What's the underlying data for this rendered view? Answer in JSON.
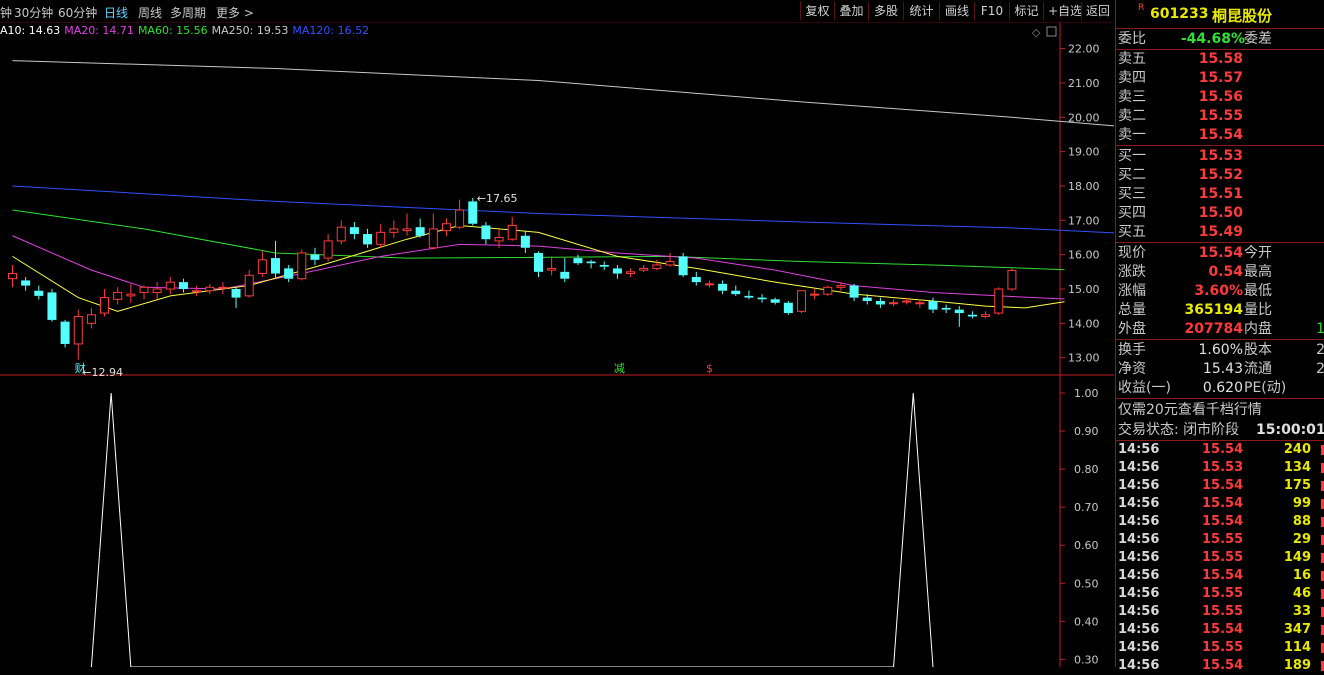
{
  "toolbar": {
    "periods": [
      {
        "label": "钟",
        "active": false
      },
      {
        "label": "30分钟",
        "active": false
      },
      {
        "label": "60分钟",
        "active": false
      },
      {
        "label": "日线",
        "active": true
      },
      {
        "label": "周线",
        "active": false
      },
      {
        "label": "多周期",
        "active": false
      },
      {
        "label": "更多 >",
        "active": false
      }
    ],
    "buttons": [
      "复权",
      "叠加",
      "多股",
      "统计",
      "画线",
      "F10",
      "标记",
      "+自选",
      "返回"
    ]
  },
  "ma_legend": [
    {
      "text": "A10: 14.63",
      "color": "#ffffff"
    },
    {
      "text": "MA20: 14.71",
      "color": "#e040e0"
    },
    {
      "text": "MA60: 15.56",
      "color": "#30e030"
    },
    {
      "text": "MA250: 19.53",
      "color": "#c8c8c8"
    },
    {
      "text": "MA120: 16.52",
      "color": "#3050ff"
    }
  ],
  "colors": {
    "up": "#ff3b3b",
    "down": "#54ffff",
    "axis_red": "#c02020"
  },
  "chart_data": [
    {
      "type": "candlestick",
      "title": "",
      "ylim": [
        12.7,
        22.25
      ],
      "y_ticks": [
        "22.00",
        "21.00",
        "20.00",
        "19.00",
        "18.00",
        "17.00",
        "16.00",
        "15.00",
        "14.00",
        "13.00"
      ],
      "candles": [
        [
          15.3,
          15.45,
          15.7,
          15.05
        ],
        [
          15.25,
          15.1,
          15.35,
          14.95
        ],
        [
          14.95,
          14.8,
          15.1,
          14.7
        ],
        [
          14.9,
          14.1,
          15.0,
          14.05
        ],
        [
          14.05,
          13.4,
          14.1,
          13.3
        ],
        [
          13.4,
          14.2,
          14.4,
          12.94
        ],
        [
          14.0,
          14.25,
          14.45,
          13.85
        ],
        [
          14.3,
          14.75,
          15.0,
          14.2
        ],
        [
          14.7,
          14.9,
          15.05,
          14.55
        ],
        [
          14.8,
          14.85,
          15.15,
          14.6
        ],
        [
          14.9,
          15.05,
          15.1,
          14.7
        ],
        [
          14.9,
          15.0,
          15.2,
          14.7
        ],
        [
          15.0,
          15.2,
          15.35,
          14.85
        ],
        [
          15.2,
          15.0,
          15.3,
          14.9
        ],
        [
          14.95,
          14.95,
          15.1,
          14.8
        ],
        [
          14.95,
          15.05,
          15.15,
          14.85
        ],
        [
          15.05,
          15.05,
          15.2,
          14.85
        ],
        [
          15.0,
          14.75,
          15.05,
          14.45
        ],
        [
          14.8,
          15.4,
          15.55,
          14.75
        ],
        [
          15.45,
          15.85,
          16.1,
          15.35
        ],
        [
          15.9,
          15.45,
          16.4,
          15.3
        ],
        [
          15.6,
          15.3,
          15.7,
          15.2
        ],
        [
          15.3,
          16.05,
          16.15,
          15.25
        ],
        [
          16.0,
          15.85,
          16.2,
          15.7
        ],
        [
          15.9,
          16.4,
          16.6,
          15.8
        ],
        [
          16.4,
          16.8,
          17.0,
          16.3
        ],
        [
          16.8,
          16.6,
          16.95,
          16.45
        ],
        [
          16.6,
          16.3,
          16.75,
          16.2
        ],
        [
          16.3,
          16.65,
          16.9,
          16.2
        ],
        [
          16.65,
          16.75,
          17.0,
          16.5
        ],
        [
          16.7,
          16.75,
          17.2,
          16.55
        ],
        [
          16.8,
          16.55,
          17.05,
          16.5
        ],
        [
          16.2,
          16.75,
          17.2,
          16.15
        ],
        [
          16.7,
          16.9,
          17.05,
          16.55
        ],
        [
          16.8,
          17.3,
          17.6,
          16.75
        ],
        [
          17.55,
          16.9,
          17.65,
          16.85
        ],
        [
          16.85,
          16.45,
          16.95,
          16.3
        ],
        [
          16.4,
          16.5,
          16.75,
          16.2
        ],
        [
          16.45,
          16.85,
          17.1,
          16.4
        ],
        [
          16.55,
          16.2,
          16.7,
          16.05
        ],
        [
          16.05,
          15.5,
          16.1,
          15.35
        ],
        [
          15.55,
          15.6,
          15.95,
          15.4
        ],
        [
          15.5,
          15.3,
          15.9,
          15.2
        ],
        [
          15.9,
          15.75,
          16.0,
          15.7
        ],
        [
          15.8,
          15.75,
          15.85,
          15.6
        ],
        [
          15.7,
          15.65,
          15.8,
          15.55
        ],
        [
          15.6,
          15.45,
          15.7,
          15.3
        ],
        [
          15.45,
          15.5,
          15.6,
          15.35
        ],
        [
          15.55,
          15.6,
          15.7,
          15.5
        ],
        [
          15.6,
          15.7,
          15.85,
          15.55
        ],
        [
          15.7,
          15.8,
          16.05,
          15.65
        ],
        [
          15.95,
          15.4,
          16.05,
          15.35
        ],
        [
          15.35,
          15.2,
          15.5,
          15.1
        ],
        [
          15.15,
          15.15,
          15.25,
          15.05
        ],
        [
          15.15,
          14.95,
          15.25,
          14.85
        ],
        [
          14.95,
          14.85,
          15.1,
          14.8
        ],
        [
          14.8,
          14.75,
          14.95,
          14.7
        ],
        [
          14.75,
          14.7,
          14.85,
          14.6
        ],
        [
          14.7,
          14.6,
          14.75,
          14.55
        ],
        [
          14.6,
          14.3,
          14.65,
          14.25
        ],
        [
          14.35,
          14.95,
          14.95,
          14.3
        ],
        [
          14.85,
          14.85,
          15.0,
          14.7
        ],
        [
          14.85,
          15.05,
          15.1,
          14.8
        ],
        [
          15.05,
          15.1,
          15.2,
          14.95
        ],
        [
          15.1,
          14.75,
          15.15,
          14.65
        ],
        [
          14.75,
          14.65,
          14.85,
          14.55
        ],
        [
          14.65,
          14.55,
          14.75,
          14.45
        ],
        [
          14.6,
          14.6,
          14.7,
          14.5
        ],
        [
          14.65,
          14.65,
          14.75,
          14.55
        ],
        [
          14.6,
          14.6,
          14.7,
          14.45
        ],
        [
          14.65,
          14.4,
          14.75,
          14.3
        ],
        [
          14.45,
          14.4,
          14.55,
          14.3
        ],
        [
          14.4,
          14.3,
          14.5,
          13.9
        ],
        [
          14.25,
          14.2,
          14.35,
          14.15
        ],
        [
          14.2,
          14.25,
          14.35,
          14.15
        ],
        [
          14.3,
          15.0,
          15.05,
          14.25
        ],
        [
          15.0,
          15.54,
          15.6,
          14.95
        ]
      ],
      "ma_lines": [
        {
          "name": "MA250",
          "color": "#c8c8c8",
          "values": [
            [
              0,
              21.65
            ],
            [
              20,
              21.42
            ],
            [
              40,
              21.07
            ],
            [
              60,
              20.45
            ],
            [
              76,
              20.0
            ],
            [
              90,
              19.55
            ]
          ]
        },
        {
          "name": "MA120",
          "color": "#3050ff",
          "values": [
            [
              0,
              18.0
            ],
            [
              20,
              17.55
            ],
            [
              40,
              17.2
            ],
            [
              60,
              16.95
            ],
            [
              76,
              16.78
            ],
            [
              90,
              16.52
            ]
          ]
        },
        {
          "name": "MA60",
          "color": "#30e030",
          "values": [
            [
              0,
              17.3
            ],
            [
              10,
              16.75
            ],
            [
              20,
              16.05
            ],
            [
              30,
              15.9
            ],
            [
              40,
              15.92
            ],
            [
              50,
              15.95
            ],
            [
              60,
              15.8
            ],
            [
              70,
              15.7
            ],
            [
              76,
              15.62
            ],
            [
              80,
              15.56
            ]
          ]
        },
        {
          "name": "MA20",
          "color": "#e040e0",
          "values": [
            [
              0,
              16.55
            ],
            [
              6,
              15.55
            ],
            [
              10,
              15.05
            ],
            [
              16,
              15.0
            ],
            [
              22,
              15.45
            ],
            [
              28,
              15.95
            ],
            [
              34,
              16.3
            ],
            [
              40,
              16.25
            ],
            [
              46,
              16.05
            ],
            [
              52,
              15.9
            ],
            [
              58,
              15.55
            ],
            [
              64,
              15.1
            ],
            [
              70,
              14.9
            ],
            [
              76,
              14.78
            ],
            [
              80,
              14.71
            ]
          ]
        },
        {
          "name": "MA10",
          "color": "#ffff40",
          "values": [
            [
              0,
              15.95
            ],
            [
              5,
              14.75
            ],
            [
              8,
              14.35
            ],
            [
              12,
              14.8
            ],
            [
              18,
              15.1
            ],
            [
              24,
              15.75
            ],
            [
              30,
              16.45
            ],
            [
              34,
              16.85
            ],
            [
              40,
              16.65
            ],
            [
              46,
              15.95
            ],
            [
              52,
              15.6
            ],
            [
              58,
              15.2
            ],
            [
              64,
              14.85
            ],
            [
              70,
              14.65
            ],
            [
              74,
              14.5
            ],
            [
              77,
              14.45
            ],
            [
              80,
              14.63
            ]
          ]
        }
      ],
      "annotations": [
        {
          "text": "17.65",
          "color": "#e0e0e0"
        },
        {
          "text": "12.94",
          "color": "#e0e0e0"
        }
      ],
      "markers": [
        {
          "text": "财",
          "color": "#54ffff"
        },
        {
          "text": "减",
          "color": "#30e030"
        },
        {
          "text": "$",
          "color": "#ff3b3b"
        }
      ]
    },
    {
      "type": "line",
      "title": "",
      "ylim": [
        0.28,
        1.05
      ],
      "y_ticks": [
        "1.00",
        "0.90",
        "0.80",
        "0.70",
        "0.60",
        "0.50",
        "0.40",
        "0.30"
      ],
      "series": [
        {
          "values": [
            [
              6,
              0.0
            ],
            [
              7.5,
              1.0
            ],
            [
              9,
              0.0
            ],
            [
              67,
              0.0
            ],
            [
              68.5,
              1.0
            ],
            [
              70,
              0.0
            ]
          ]
        }
      ]
    }
  ],
  "stock": {
    "code": "601233",
    "name": "桐昆股份",
    "badge": "R"
  },
  "order_book": {
    "wei_bi_label": "委比",
    "wei_bi_value": "-44.68%",
    "wei_cha_label": "委差",
    "asks": [
      {
        "label": "卖五",
        "price": "15.58"
      },
      {
        "label": "卖四",
        "price": "15.57"
      },
      {
        "label": "卖三",
        "price": "15.56"
      },
      {
        "label": "卖二",
        "price": "15.55"
      },
      {
        "label": "卖一",
        "price": "15.54"
      }
    ],
    "bids": [
      {
        "label": "买一",
        "price": "15.53"
      },
      {
        "label": "买二",
        "price": "15.52"
      },
      {
        "label": "买三",
        "price": "15.51"
      },
      {
        "label": "买四",
        "price": "15.50"
      },
      {
        "label": "买五",
        "price": "15.49"
      }
    ]
  },
  "quote": [
    {
      "l1": "现价",
      "v1": "15.54",
      "c1": "#ff3b3b",
      "l2": "今开",
      "v2": ""
    },
    {
      "l1": "涨跌",
      "v1": "0.54",
      "c1": "#ff3b3b",
      "l2": "最高",
      "v2": ""
    },
    {
      "l1": "涨幅",
      "v1": "3.60%",
      "c1": "#ff3b3b",
      "l2": "最低",
      "v2": ""
    },
    {
      "l1": "总量",
      "v1": "365194",
      "c1": "#e8e800",
      "l2": "量比",
      "v2": ""
    },
    {
      "l1": "外盘",
      "v1": "207784",
      "c1": "#ff3b3b",
      "l2": "内盘",
      "v2": "1"
    }
  ],
  "fundamentals": [
    {
      "l1": "换手",
      "v1": "1.60%",
      "l2": "股本",
      "v2": "2"
    },
    {
      "l1": "净资",
      "v1": "15.43",
      "l2": "流通",
      "v2": "2"
    },
    {
      "l1": "收益(一)",
      "v1": "0.620",
      "l2": "PE(动)",
      "v2": ""
    }
  ],
  "notice": "仅需20元查看千档行情",
  "trade_status": {
    "label": "交易状态: 闭市阶段",
    "time": "15:00:01"
  },
  "ticks": [
    {
      "time": "14:56",
      "price": "15.54",
      "vol": "240"
    },
    {
      "time": "14:56",
      "price": "15.53",
      "vol": "134"
    },
    {
      "time": "14:56",
      "price": "15.54",
      "vol": "175"
    },
    {
      "time": "14:56",
      "price": "15.54",
      "vol": "99"
    },
    {
      "time": "14:56",
      "price": "15.54",
      "vol": "88"
    },
    {
      "time": "14:56",
      "price": "15.55",
      "vol": "29"
    },
    {
      "time": "14:56",
      "price": "15.55",
      "vol": "149"
    },
    {
      "time": "14:56",
      "price": "15.54",
      "vol": "16"
    },
    {
      "time": "14:56",
      "price": "15.55",
      "vol": "46"
    },
    {
      "time": "14:56",
      "price": "15.55",
      "vol": "33"
    },
    {
      "time": "14:56",
      "price": "15.54",
      "vol": "347"
    },
    {
      "time": "14:56",
      "price": "15.55",
      "vol": "114"
    },
    {
      "time": "14:56",
      "price": "15.54",
      "vol": "189"
    }
  ]
}
